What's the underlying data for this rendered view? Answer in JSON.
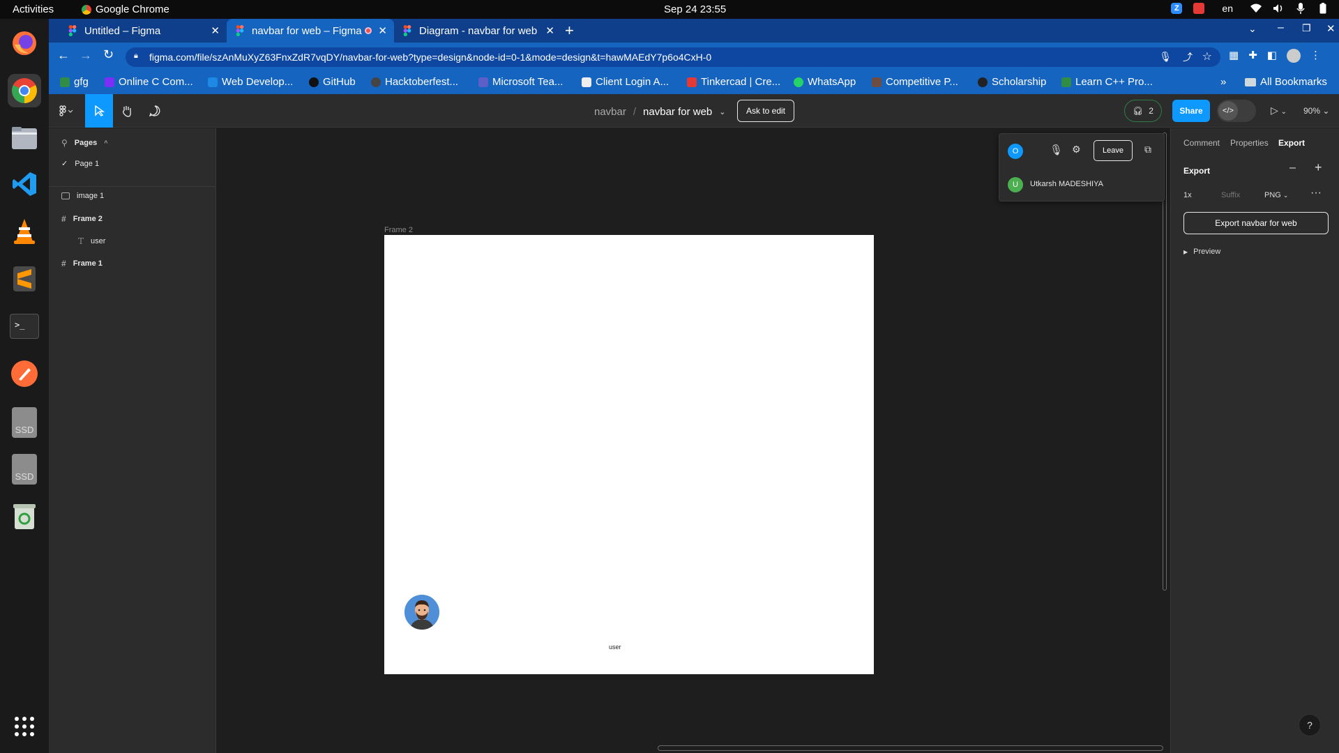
{
  "system": {
    "activities": "Activities",
    "app_name": "Google Chrome",
    "clock": "Sep 24  23:55",
    "lang": "en"
  },
  "dock": {
    "items": [
      "firefox-icon",
      "chrome-icon",
      "files-icon",
      "vscode-icon",
      "vlc-icon",
      "sublime-icon",
      "terminal-icon",
      "postman-icon",
      "ssd-drive-icon",
      "ssd-drive-icon",
      "trash-icon",
      "app-grid-icon"
    ],
    "ssd_label": "SSD"
  },
  "browser": {
    "tabs": [
      {
        "label": "Untitled – Figma"
      },
      {
        "label": "navbar for web – Figma"
      },
      {
        "label": "Diagram - navbar for web"
      }
    ],
    "url": "figma.com/file/szAnMuXyZ63FnxZdR7vqDY/navbar-for-web?type=design&node-id=0-1&mode=design&t=hawMAEdY7p6o4CxH-0",
    "bookmarks": [
      {
        "label": "gfg",
        "color": "#2f8d46"
      },
      {
        "label": "Online C Com...",
        "color": "#7b2ff7"
      },
      {
        "label": "Web Develop...",
        "color": "#1e88e5"
      },
      {
        "label": "GitHub",
        "color": "#111111"
      },
      {
        "label": "Hacktoberfest...",
        "color": "#444444"
      },
      {
        "label": "Microsoft Tea...",
        "color": "#5b5fc7"
      },
      {
        "label": "Client Login A...",
        "color": "#eeeeee"
      },
      {
        "label": "Tinkercad | Cre...",
        "color": "#e53935"
      },
      {
        "label": "WhatsApp",
        "color": "#25d366"
      },
      {
        "label": "Competitive P...",
        "color": "#6d4c41"
      },
      {
        "label": "Scholarship",
        "color": "#222222"
      },
      {
        "label": "Learn C++ Pro...",
        "color": "#2f8d46"
      }
    ],
    "more_bookmarks": "»",
    "all_bookmarks": "All Bookmarks"
  },
  "figma": {
    "breadcrumb_project": "navbar",
    "breadcrumb_sep": "/",
    "file_name": "navbar for web",
    "ask_to_edit": "Ask to edit",
    "huddle_count": "2",
    "share": "Share",
    "zoom": "90%",
    "pages_header": "Pages",
    "pages": [
      {
        "label": "Page 1"
      }
    ],
    "layers": [
      {
        "label": "image 1",
        "type": "image"
      },
      {
        "label": "Frame 2",
        "type": "frame"
      },
      {
        "label": "user",
        "type": "text"
      },
      {
        "label": "Frame 1",
        "type": "frame"
      }
    ],
    "frame_label": "Frame 2",
    "frame_text": "user",
    "huddle": {
      "leave": "Leave",
      "self_initial": "O",
      "participant_initial": "U",
      "participant_name": "Utkarsh MADESHIYA"
    },
    "right_tabs": [
      "Comment",
      "Properties",
      "Export"
    ],
    "export": {
      "title": "Export",
      "scale": "1x",
      "suffix_placeholder": "Suffix",
      "format": "PNG",
      "button": "Export navbar for web",
      "preview": "Preview"
    },
    "help": "?"
  },
  "colors": {
    "accent": "#0d99ff",
    "chrome_blue": "#1565c0",
    "canvas": "#1e1e1e"
  }
}
